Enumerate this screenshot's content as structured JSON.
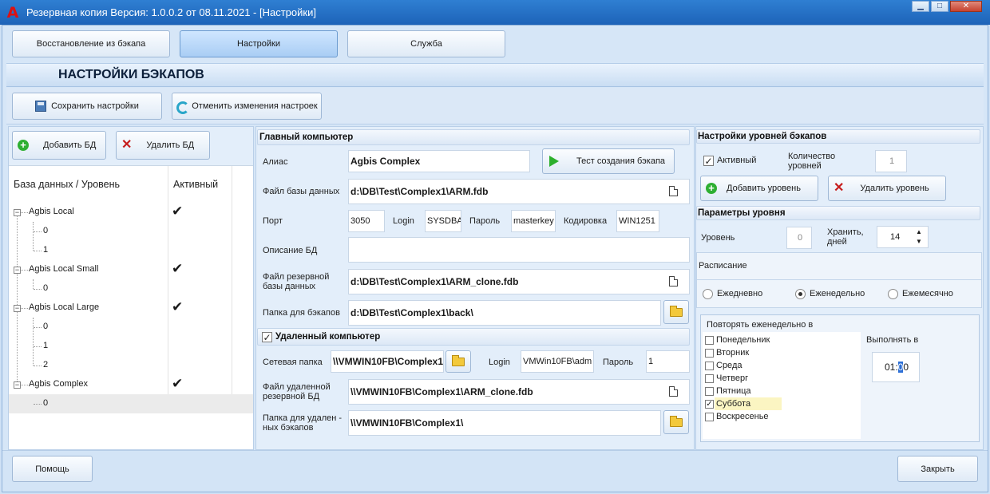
{
  "window": {
    "title": "Резервная копия   Версия: 1.0.0.2 от 08.11.2021 - [Настройки]",
    "app_icon": "A",
    "controls": [
      "▁",
      "□",
      "✕"
    ]
  },
  "tabs": [
    {
      "label": "Восстановление из бэкапа"
    },
    {
      "label": "Настройки"
    },
    {
      "label": "Служба"
    }
  ],
  "page_title": "НАСТРОЙКИ БЭКАПОВ",
  "toolbar": {
    "save_label": "Сохранить настройки",
    "revert_label": "Отменить изменения настроек"
  },
  "db_panel": {
    "add_label": "Добавить БД",
    "delete_label": "Удалить БД",
    "col_db": "База данных / Уровень",
    "col_active": "Активный",
    "check": "✔",
    "rows": [
      {
        "name": "Agbis Local",
        "level": 0,
        "active": true
      },
      {
        "name": "0",
        "level": 1,
        "active": false
      },
      {
        "name": "1",
        "level": 1,
        "active": false
      },
      {
        "name": "Agbis Local Small",
        "level": 0,
        "active": true
      },
      {
        "name": "0",
        "level": 1,
        "active": false
      },
      {
        "name": "Agbis Local Large",
        "level": 0,
        "active": true
      },
      {
        "name": "0",
        "level": 1,
        "active": false
      },
      {
        "name": "1",
        "level": 1,
        "active": false
      },
      {
        "name": "2",
        "level": 1,
        "active": false
      },
      {
        "name": "Agbis Complex",
        "level": 0,
        "active": true
      },
      {
        "name": "0",
        "level": 1,
        "active": false,
        "selected": true
      }
    ]
  },
  "main_computer": {
    "title": "Главный компьютер",
    "alias_label": "Алиас",
    "alias_value": "Agbis Complex",
    "test_label": "Тест создания бэкапа",
    "dbfile_label": "Файл базы данных",
    "dbfile_value": "d:\\DB\\Test\\Complex1\\ARM.fdb",
    "port_label": "Порт",
    "port_value": "3050",
    "login_label": "Login",
    "login_value": "SYSDBA",
    "password_label": "Пароль",
    "password_value": "masterkey",
    "encoding_label": "Кодировка",
    "encoding_value": "WIN1251",
    "description_label": "Описание БД",
    "description_value": "",
    "backup_file_label_1": "Файл резервной",
    "backup_file_label_2": "базы данных",
    "backup_file_value": "d:\\DB\\Test\\Complex1\\ARM_clone.fdb",
    "backup_folder_label": "Папка для бэкапов",
    "backup_folder_value": "d:\\DB\\Test\\Complex1\\back\\"
  },
  "remote_computer": {
    "title": "Удаленный компьютер",
    "enabled": true,
    "network_folder_label": "Сетевая папка",
    "network_folder_value": "\\\\VMWIN10FB\\Complex1",
    "login_label": "Login",
    "login_value": "VMWin10FB\\adm",
    "password_label": "Пароль",
    "password_value": "1",
    "remote_file_label_1": "Файл удаленной",
    "remote_file_label_2": "резервной БД",
    "remote_file_value": "\\\\VMWIN10FB\\Complex1\\ARM_clone.fdb",
    "remote_folder_label_1": "Папка для удален -",
    "remote_folder_label_2": "ных бэкапов",
    "remote_folder_value": "\\\\VMWIN10FB\\Complex1\\"
  },
  "levels": {
    "title": "Настройки уровней бэкапов",
    "active_label": "Активный",
    "active": true,
    "count_label_1": "Количество",
    "count_label_2": "уровней",
    "count_value": "1",
    "add_label": "Добавить уровень",
    "delete_label": "Удалить уровень"
  },
  "level_params": {
    "title": "Параметры уровня",
    "level_label": "Уровень",
    "level_value": "0",
    "keep_label_1": "Хранить,",
    "keep_label_2": "дней",
    "keep_value": "14",
    "schedule_label": "Расписание",
    "schedule_options": [
      {
        "label": "Ежедневно",
        "selected": false
      },
      {
        "label": "Еженедельно",
        "selected": true
      },
      {
        "label": "Ежемесячно",
        "selected": false
      }
    ],
    "repeat_label": "Повторять еженедельно в",
    "days": [
      {
        "label": "Понедельник",
        "checked": false
      },
      {
        "label": "Вторник",
        "checked": false
      },
      {
        "label": "Среда",
        "checked": false
      },
      {
        "label": "Четверг",
        "checked": false
      },
      {
        "label": "Пятница",
        "checked": false
      },
      {
        "label": "Суббота",
        "checked": true
      },
      {
        "label": "Воскресенье",
        "checked": false
      }
    ],
    "run_at_label": "Выполнять в",
    "run_at_value_a": "01:",
    "run_at_value_b": "0",
    "run_at_value_c": "0"
  },
  "footer": {
    "help_label": "Помощь",
    "close_label": "Закрыть"
  },
  "colors": {
    "titlebar": "#1d63b8",
    "accent": "#a9cdf4",
    "selected_day": "#fbf5c2"
  }
}
